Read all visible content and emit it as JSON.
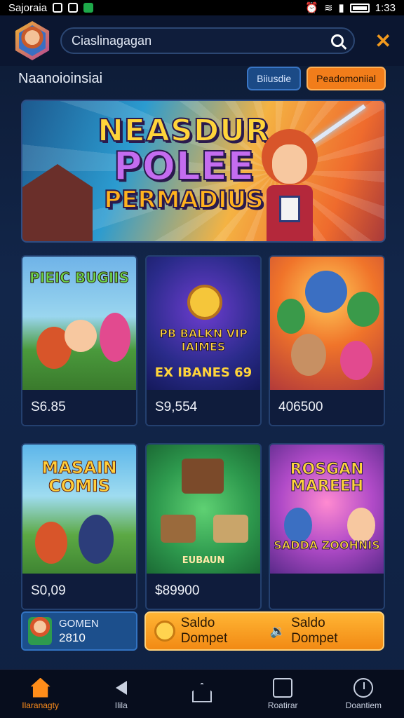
{
  "status_bar": {
    "carrier": "Sajoraia",
    "time": "1:33"
  },
  "header": {
    "search_text": "Ciaslinagagan"
  },
  "section": {
    "title": "Naanoioinsiai",
    "tab_blue": "Biiusdie",
    "tab_orange": "Peadomoniial"
  },
  "banner": {
    "line1": "NEASDUR",
    "line2": "POLEE",
    "line3": "PERMADIUS"
  },
  "cards": [
    {
      "art_title": "PIEIC BUGIIS",
      "price": "S6.85",
      "accent": "#3b8c2a"
    },
    {
      "art_title": "PB BALKN VIP IAIMES",
      "badge": "EX IBANES 69",
      "price": "S9,554",
      "accent": "#ffd43a"
    },
    {
      "art_title": "",
      "price": "406500",
      "accent": "#f0742a"
    },
    {
      "art_title": "MASAIN COMIS",
      "price": "S0,09",
      "accent": "#ffd43a"
    },
    {
      "art_title": "EUBAUN",
      "price": "$89900",
      "accent": "#2e9a4e"
    },
    {
      "art_title": "ROSGAN MAREEH",
      "badge": "SADDA ZOOHNIS",
      "price": "",
      "accent": "#ff8ad0"
    }
  ],
  "mini_card": {
    "label": "GOMEN",
    "value": "2810"
  },
  "wallet_button": {
    "left_label": "Saldo Dompet",
    "separator": "🔉",
    "right_label": "Saldo Dompet"
  },
  "bottom_nav": [
    {
      "label": "Ilaranagty",
      "icon": "home-icon",
      "active": true
    },
    {
      "label": "Ilila",
      "icon": "back-icon",
      "active": false
    },
    {
      "label": "",
      "icon": "homebtn-icon",
      "active": false
    },
    {
      "label": "Roatirar",
      "icon": "chat-icon",
      "active": false
    },
    {
      "label": "Doantiem",
      "icon": "clock-icon",
      "active": false
    }
  ]
}
